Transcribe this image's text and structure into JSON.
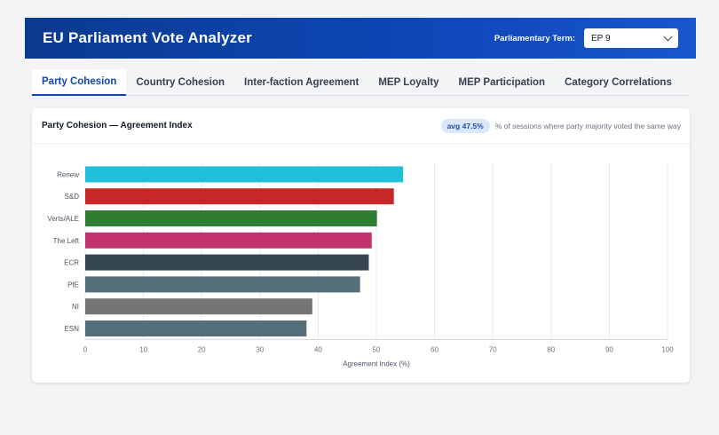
{
  "header": {
    "title": "EU Parliament Vote Analyzer",
    "term_label": "Parliamentary Term:",
    "term_value": "EP 9"
  },
  "tabs": [
    {
      "label": "Party Cohesion",
      "active": true
    },
    {
      "label": "Country Cohesion",
      "active": false
    },
    {
      "label": "Inter-faction Agreement",
      "active": false
    },
    {
      "label": "MEP Loyalty",
      "active": false
    },
    {
      "label": "MEP Participation",
      "active": false
    },
    {
      "label": "Category Correlations",
      "active": false
    }
  ],
  "card": {
    "title": "Party Cohesion — Agreement Index",
    "badge": "avg 47.5%",
    "description": "% of sessions where party majority voted the same way"
  },
  "chart_data": {
    "type": "bar",
    "orientation": "horizontal",
    "categories": [
      "Renew",
      "S&D",
      "Verts/ALE",
      "The Left",
      "ECR",
      "PfE",
      "NI",
      "ESN"
    ],
    "values": [
      54.6,
      53.0,
      50.1,
      49.2,
      48.7,
      47.2,
      39.0,
      38.0
    ],
    "colors": [
      "#1fc0d8",
      "#c62828",
      "#2e7d32",
      "#c2336d",
      "#37474f",
      "#546e7a",
      "#757575",
      "#546e7a"
    ],
    "xlabel": "Agreement Index (%)",
    "xlim": [
      0,
      100
    ],
    "xticks": [
      "0",
      "10",
      "20",
      "30",
      "40",
      "50",
      "60",
      "70",
      "80",
      "90",
      "100"
    ],
    "grid": true
  }
}
